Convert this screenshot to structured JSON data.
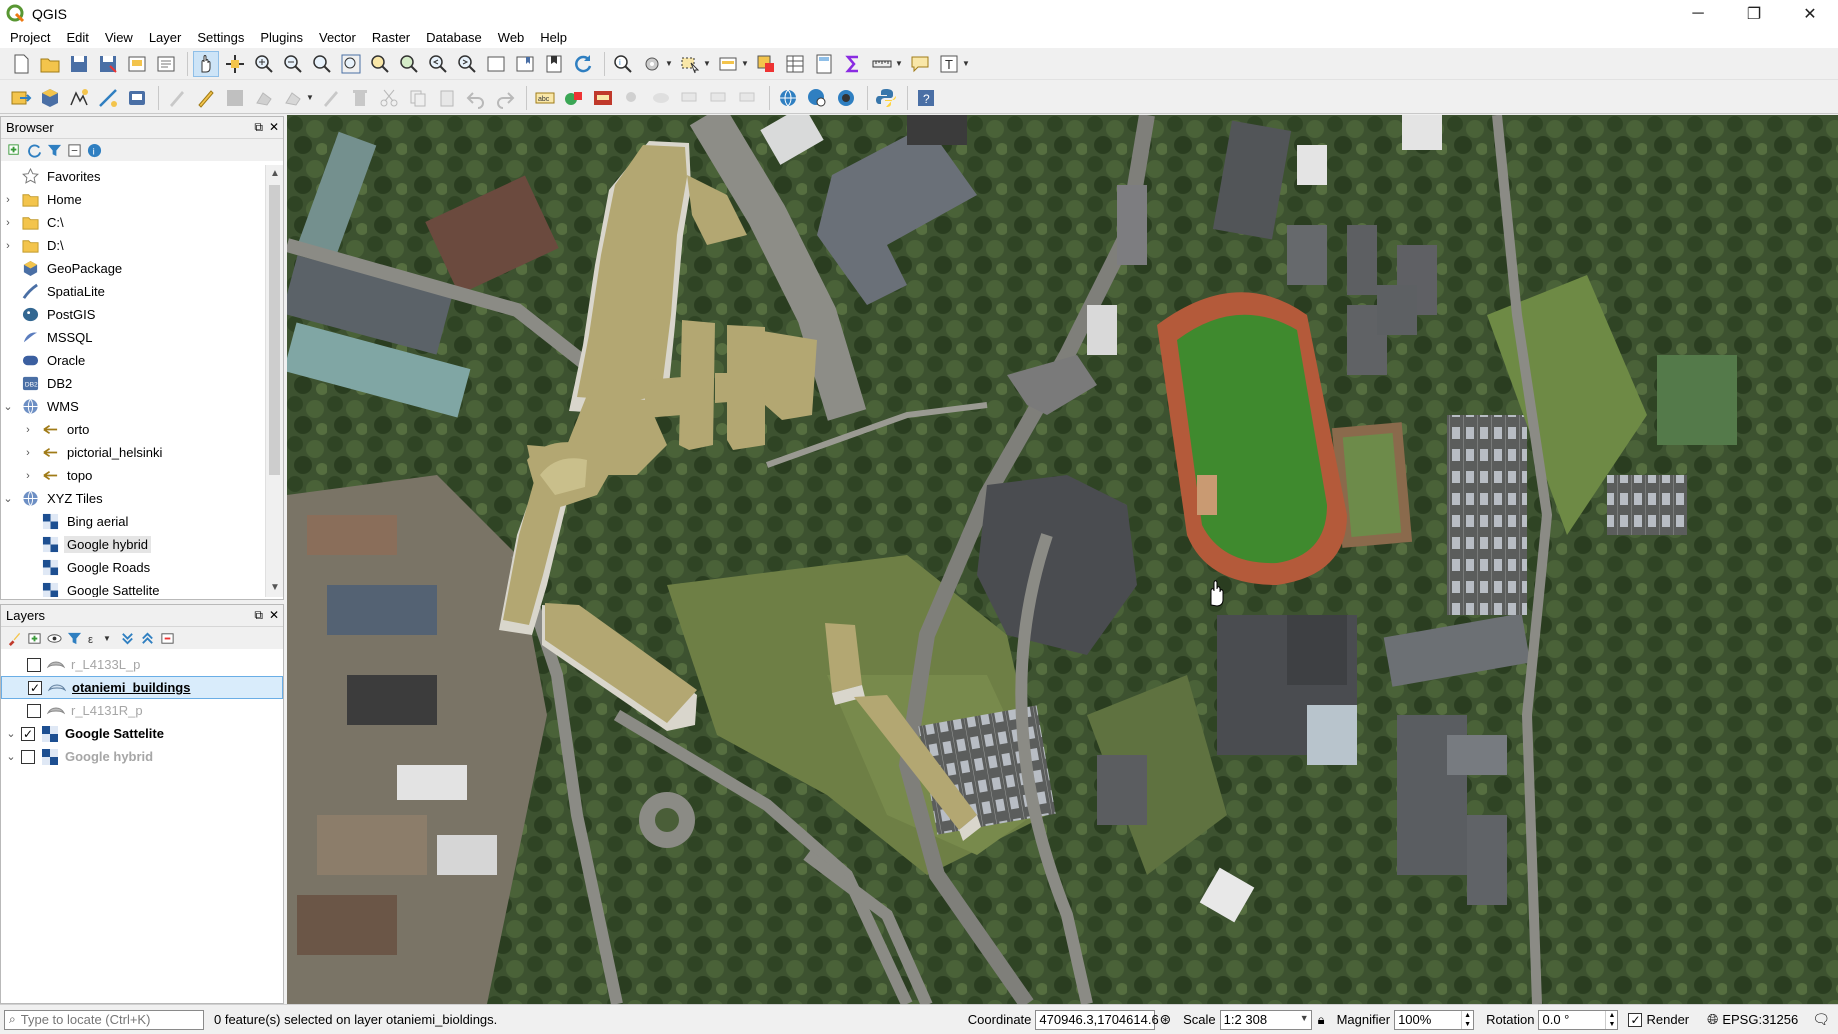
{
  "app": {
    "title": "QGIS"
  },
  "window_controls": {
    "minimize": "─",
    "restore": "❐",
    "close": "✕"
  },
  "menu": [
    "Project",
    "Edit",
    "View",
    "Layer",
    "Settings",
    "Plugins",
    "Vector",
    "Raster",
    "Database",
    "Web",
    "Help"
  ],
  "toolbar_text": {
    "abc": "abc",
    "text_tool": "T"
  },
  "browser": {
    "title": "Browser",
    "items": [
      {
        "label": "Favorites",
        "icon": "star-icon",
        "expand": ""
      },
      {
        "label": "Home",
        "icon": "folder-icon",
        "expand": "›"
      },
      {
        "label": "C:\\",
        "icon": "folder-icon",
        "expand": "›"
      },
      {
        "label": "D:\\",
        "icon": "folder-icon",
        "expand": "›"
      },
      {
        "label": "GeoPackage",
        "icon": "geopackage-icon",
        "expand": ""
      },
      {
        "label": "SpatiaLite",
        "icon": "spatialite-icon",
        "expand": ""
      },
      {
        "label": "PostGIS",
        "icon": "postgis-icon",
        "expand": ""
      },
      {
        "label": "MSSQL",
        "icon": "mssql-icon",
        "expand": ""
      },
      {
        "label": "Oracle",
        "icon": "oracle-icon",
        "expand": ""
      },
      {
        "label": "DB2",
        "icon": "db2-icon",
        "expand": ""
      },
      {
        "label": "WMS",
        "icon": "globe-icon",
        "expand": "⌄"
      },
      {
        "label": "orto",
        "icon": "wms-layer-icon",
        "expand": "›"
      },
      {
        "label": "pictorial_helsinki",
        "icon": "wms-layer-icon",
        "expand": "›"
      },
      {
        "label": "topo",
        "icon": "wms-layer-icon",
        "expand": "›"
      },
      {
        "label": "XYZ Tiles",
        "icon": "globe-icon",
        "expand": "⌄"
      },
      {
        "label": "Bing aerial",
        "icon": "tiles-icon",
        "expand": ""
      },
      {
        "label": "Google hybrid",
        "icon": "tiles-icon",
        "expand": ""
      },
      {
        "label": "Google Roads",
        "icon": "tiles-icon",
        "expand": ""
      },
      {
        "label": "Google Sattelite",
        "icon": "tiles-icon",
        "expand": ""
      }
    ],
    "db2_badge": "DB2"
  },
  "layers": {
    "title": "Layers",
    "items": [
      {
        "label": "r_L4133L_p",
        "checked": false,
        "expand": ""
      },
      {
        "label": "otaniemi_buildings",
        "checked": true,
        "expand": ""
      },
      {
        "label": "r_L4131R_p",
        "checked": false,
        "expand": ""
      },
      {
        "label": "Google Sattelite",
        "checked": true,
        "expand": "⌄"
      },
      {
        "label": "Google hybrid",
        "checked": false,
        "expand": "⌄"
      }
    ]
  },
  "statusbar": {
    "locate_placeholder": "Type to locate (Ctrl+K)",
    "message": "0 feature(s) selected on layer otaniemi_bioldings.",
    "coordinate_label": "Coordinate",
    "coordinate_value": "470946.3,1704614.6",
    "scale_label": "Scale",
    "scale_value": "1:2 308",
    "magnifier_label": "Magnifier",
    "magnifier_value": "100%",
    "rotation_label": "Rotation",
    "rotation_value": "0.0 °",
    "render_label": "Render",
    "render_checked": true,
    "crs": "EPSG:31256"
  },
  "colors": {
    "building_fill": "#b3a772",
    "building_wall": "#d9d6cc",
    "track": "#b45a3a",
    "field": "#3f8a2e",
    "selection": "#d9ecfb"
  }
}
